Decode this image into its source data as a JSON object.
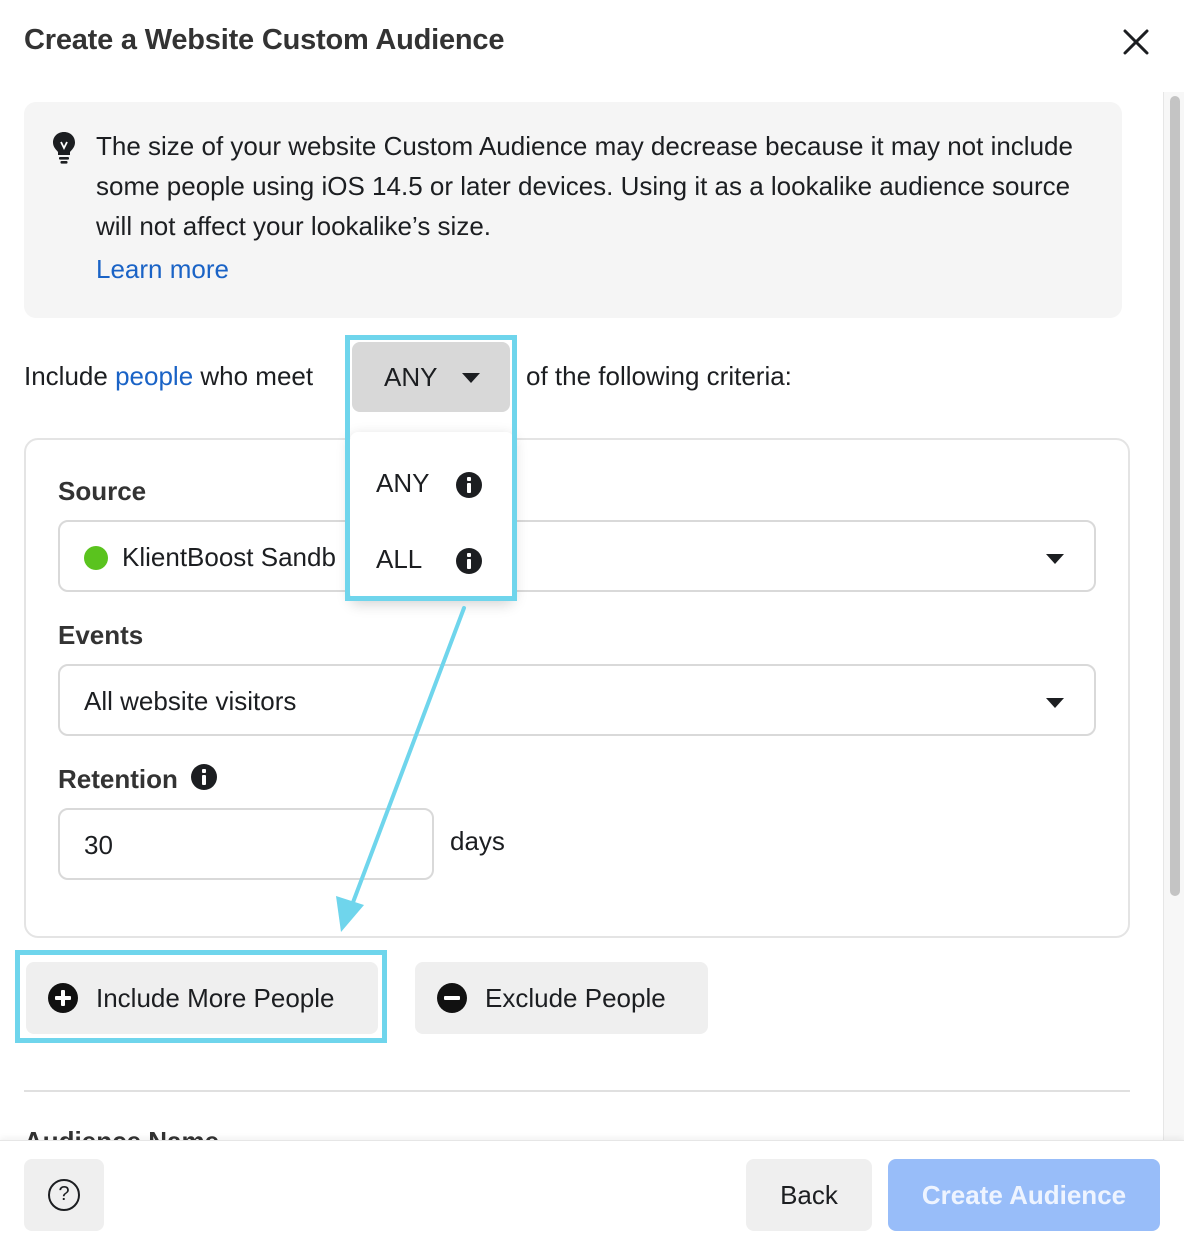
{
  "dialog": {
    "title": "Create a Website Custom Audience",
    "close_icon": "close-icon"
  },
  "notice": {
    "icon": "lightbulb-icon",
    "text": "The size of your website Custom Audience may decrease because it may not include some people using iOS 14.5 or later devices. Using it as a lookalike audience source will not affect your lookalike’s size.",
    "link": "Learn more"
  },
  "criteria": {
    "prefix": "Include ",
    "link": "people",
    "middle": " who meet",
    "suffix": "of the following criteria:",
    "selected": "ANY",
    "options": [
      {
        "label": "ANY",
        "icon": "info-icon"
      },
      {
        "label": "ALL",
        "icon": "info-icon"
      }
    ]
  },
  "rule": {
    "source_label": "Source",
    "source_value": "KlientBoost Sandb",
    "source_status_color": "#5ac31e",
    "events_label": "Events",
    "events_value": "All website visitors",
    "retention_label": "Retention",
    "retention_value": "30",
    "retention_unit": "days"
  },
  "actions": {
    "include_more": "Include More People",
    "exclude": "Exclude People"
  },
  "next_section_label": "Audience Name",
  "footer": {
    "help_icon": "help-icon",
    "back": "Back",
    "create": "Create Audience"
  },
  "colors": {
    "link": "#1a63c6",
    "highlight": "#6fd5ec",
    "primary_disabled": "#98bdf9"
  }
}
